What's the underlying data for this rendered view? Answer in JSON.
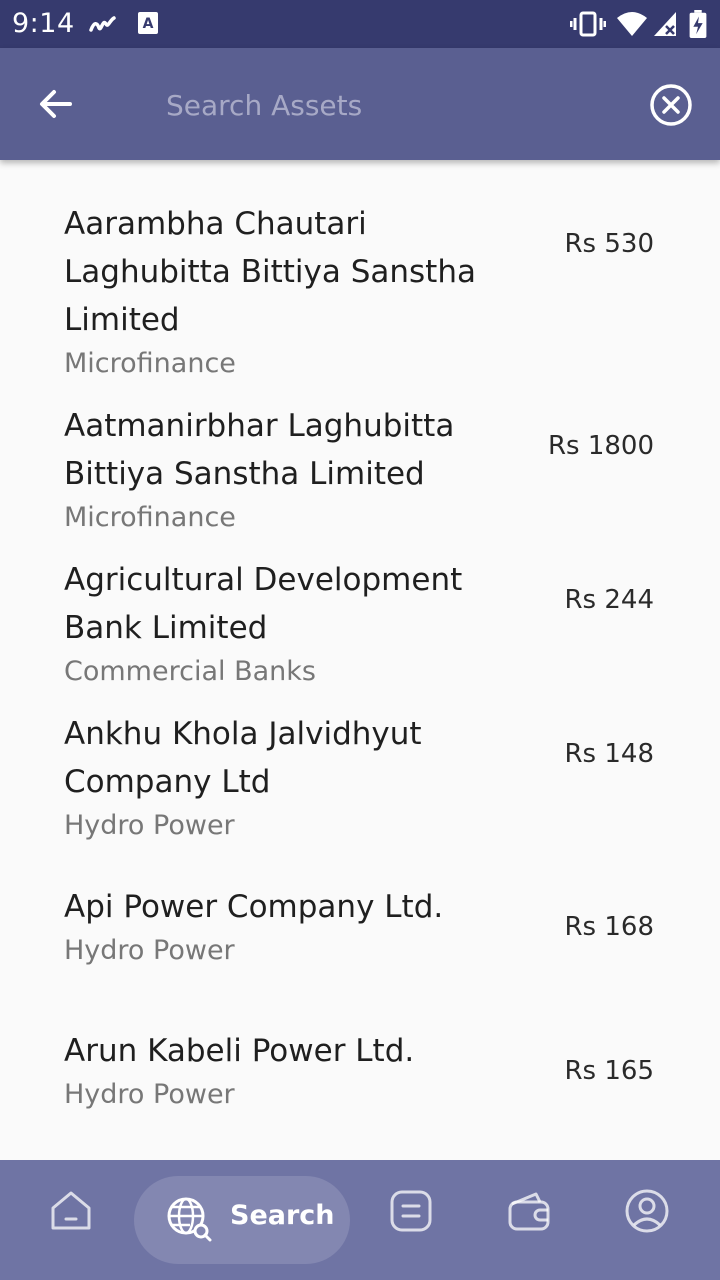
{
  "status_bar": {
    "time": "9:14"
  },
  "search": {
    "placeholder": "Search Assets",
    "value": ""
  },
  "assets": [
    {
      "name": "Aarambha Chautari Laghubitta Bittiya Sanstha Limited",
      "category": "Microfinance",
      "price": "Rs 530"
    },
    {
      "name": "Aatmanirbhar Laghubitta Bittiya Sanstha Limited",
      "category": "Microfinance",
      "price": "Rs 1800"
    },
    {
      "name": "Agricultural Development Bank Limited",
      "category": "Commercial Banks",
      "price": "Rs 244"
    },
    {
      "name": "Ankhu Khola Jalvidhyut Company Ltd",
      "category": "Hydro Power",
      "price": "Rs 148"
    },
    {
      "name": "Api Power Company Ltd.",
      "category": "Hydro Power",
      "price": "Rs 168"
    },
    {
      "name": "Arun Kabeli Power Ltd.",
      "category": "Hydro Power",
      "price": "Rs 165"
    }
  ],
  "bottom_nav": {
    "items": [
      {
        "icon": "home-icon",
        "label": ""
      },
      {
        "icon": "globe-search-icon",
        "label": "Search",
        "active": true
      },
      {
        "icon": "orders-icon",
        "label": ""
      },
      {
        "icon": "wallet-icon",
        "label": ""
      },
      {
        "icon": "profile-icon",
        "label": ""
      }
    ]
  },
  "colors": {
    "status_bar": "#363a6e",
    "app_bar": "#5a5f91",
    "bottom_nav": "#6f74a4",
    "active_pill": "#8387b1"
  }
}
